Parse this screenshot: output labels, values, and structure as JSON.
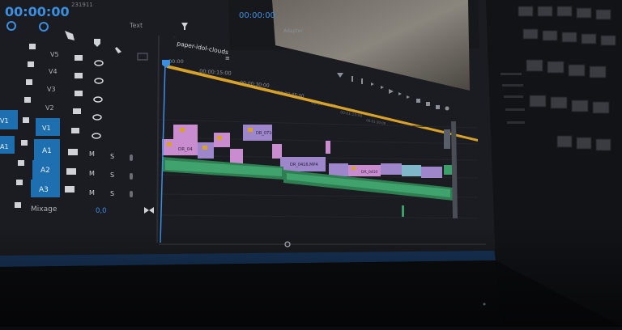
{
  "timeline": {
    "timecode": "00:00:00",
    "frame_counter": "231911",
    "sequence_tab": "paper-idol-clouds",
    "panel_label_text": "Text",
    "ruler": [
      "00:00",
      "00:00:15:00",
      "00:00:30:00",
      "00:00:45:00",
      "00:01:00:00",
      "00:01:15:00",
      "00:01:30:00"
    ],
    "mixage_label": "Mixage",
    "mixage_value": "0,0",
    "tracks": [
      {
        "id": "V5",
        "kind": "video"
      },
      {
        "id": "V4",
        "kind": "video"
      },
      {
        "id": "V3",
        "kind": "video"
      },
      {
        "id": "V2",
        "kind": "video"
      },
      {
        "id": "V1",
        "kind": "video",
        "source": "V1"
      },
      {
        "id": "A1",
        "kind": "audio",
        "source": "A1",
        "mute": "M",
        "solo": "S"
      },
      {
        "id": "A2",
        "kind": "audio",
        "source": "A2",
        "mute": "M",
        "solo": "S"
      },
      {
        "id": "A3",
        "kind": "audio",
        "source": "A3",
        "mute": "M",
        "solo": "S"
      }
    ],
    "clips": [
      {
        "label": "DR_04",
        "track": "V1"
      },
      {
        "label": "DR_0710",
        "track": "V2"
      },
      {
        "label": "DR_0416.MP4",
        "track": "V1"
      },
      {
        "label": "DR_0410",
        "track": "V1"
      }
    ]
  },
  "monitor": {
    "timecode": "00:00:00",
    "fit_label": "Adapter"
  },
  "colors": {
    "accent_blue": "#1e6fb0",
    "playhead": "#3c8fe0",
    "clip_pink": "#c98ccf",
    "clip_lilac": "#9d86c9",
    "audio_green": "#3d9e6a",
    "work_area": "#d8a22a"
  }
}
